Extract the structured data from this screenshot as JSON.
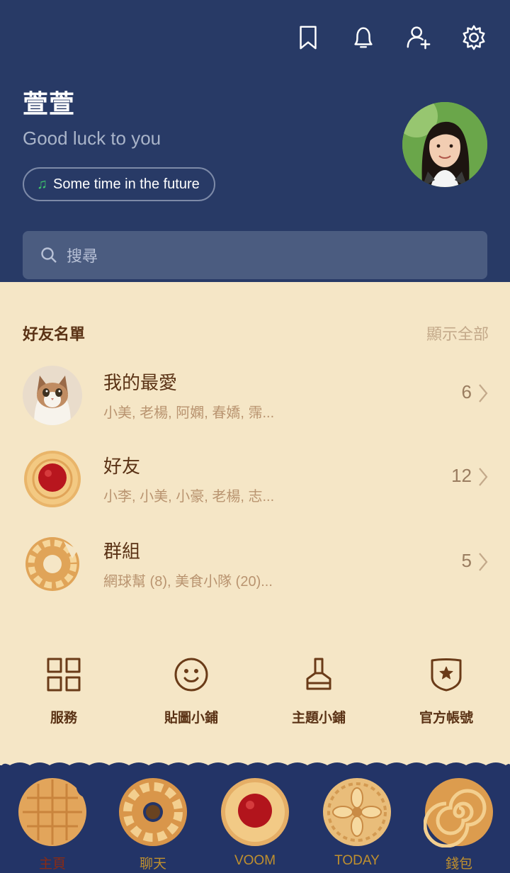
{
  "header": {
    "icons": [
      "bookmark-icon",
      "bell-icon",
      "add-friend-icon",
      "gear-icon"
    ],
    "name": "萱萱",
    "status": "Good luck to you",
    "music": "Some time in the future",
    "search_placeholder": "搜尋"
  },
  "friends": {
    "title": "好友名單",
    "show_all": "顯示全部",
    "rows": [
      {
        "title": "我的最愛",
        "members": "小美, 老楊, 阿嫻, 春嬌, 霈...",
        "count": "6"
      },
      {
        "title": "好友",
        "members": "小李, 小美, 小豪, 老楊, 志...",
        "count": "12"
      },
      {
        "title": "群組",
        "members": "網球幫 (8), 美食小隊 (20)...",
        "count": "5"
      }
    ]
  },
  "actions": [
    {
      "label": "服務",
      "icon": "grid-icon"
    },
    {
      "label": "貼圖小鋪",
      "icon": "smiley-icon"
    },
    {
      "label": "主題小鋪",
      "icon": "brush-icon"
    },
    {
      "label": "官方帳號",
      "icon": "shield-star-icon"
    }
  ],
  "nav": [
    {
      "label": "主頁",
      "active": true
    },
    {
      "label": "聊天",
      "active": false
    },
    {
      "label": "VOOM",
      "active": false
    },
    {
      "label": "TODAY",
      "active": false
    },
    {
      "label": "錢包",
      "active": false
    }
  ],
  "colors": {
    "header_bg": "#283a66",
    "body_bg": "#f5e6c6",
    "nav_bg": "#233467",
    "text_brown": "#5a3215",
    "nav_label": "#c0902e",
    "nav_active": "#8a2b14"
  }
}
